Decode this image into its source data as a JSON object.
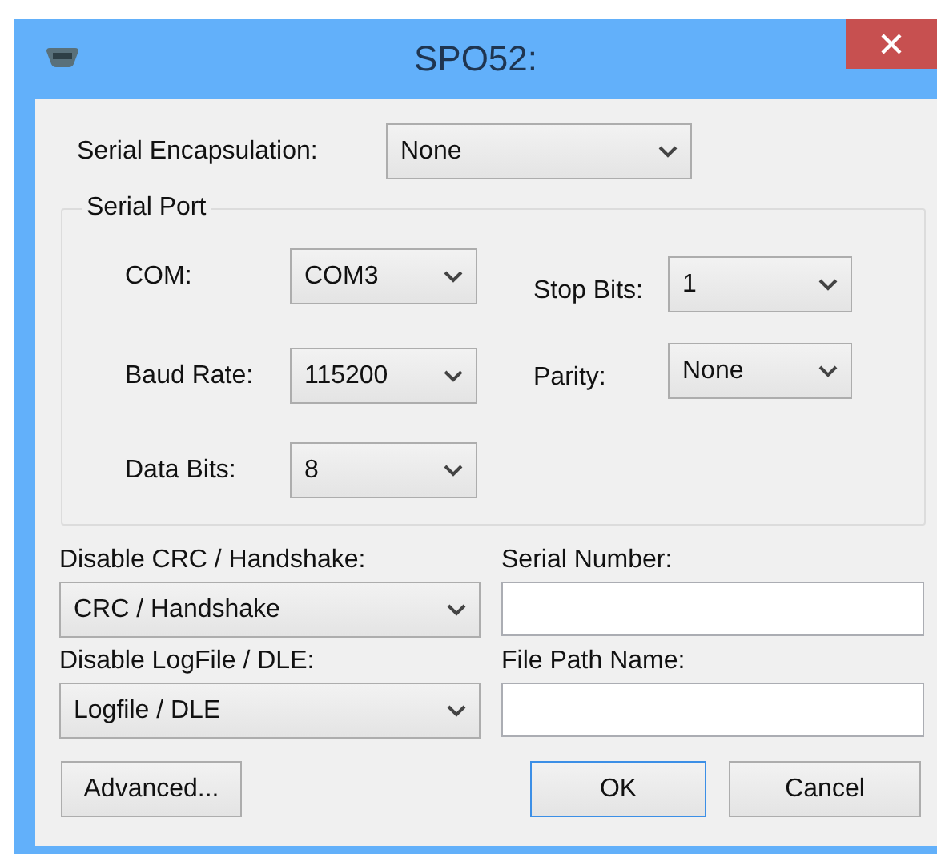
{
  "window": {
    "title": "SPO52:"
  },
  "encapsulation": {
    "label": "Serial Encapsulation:",
    "value": "None"
  },
  "serial_port": {
    "title": "Serial Port",
    "left": [
      {
        "label": "COM:",
        "value": "COM3"
      },
      {
        "label": "Baud Rate:",
        "value": "115200"
      },
      {
        "label": "Data Bits:",
        "value": "8"
      }
    ],
    "right": [
      {
        "label": "Stop Bits:",
        "value": "1"
      },
      {
        "label": "Parity:",
        "value": "None"
      }
    ]
  },
  "options": [
    {
      "label": "Disable CRC / Handshake:",
      "value": "CRC / Handshake"
    },
    {
      "label": "Disable LogFile / DLE:",
      "value": "Logfile / DLE"
    }
  ],
  "fields": [
    {
      "label": "Serial Number:"
    },
    {
      "label": "File Path Name:"
    }
  ],
  "buttons": [
    {
      "label": "Advanced...",
      "focused": false
    },
    {
      "label": "OK",
      "focused": true
    },
    {
      "label": "Cancel",
      "focused": false
    }
  ]
}
